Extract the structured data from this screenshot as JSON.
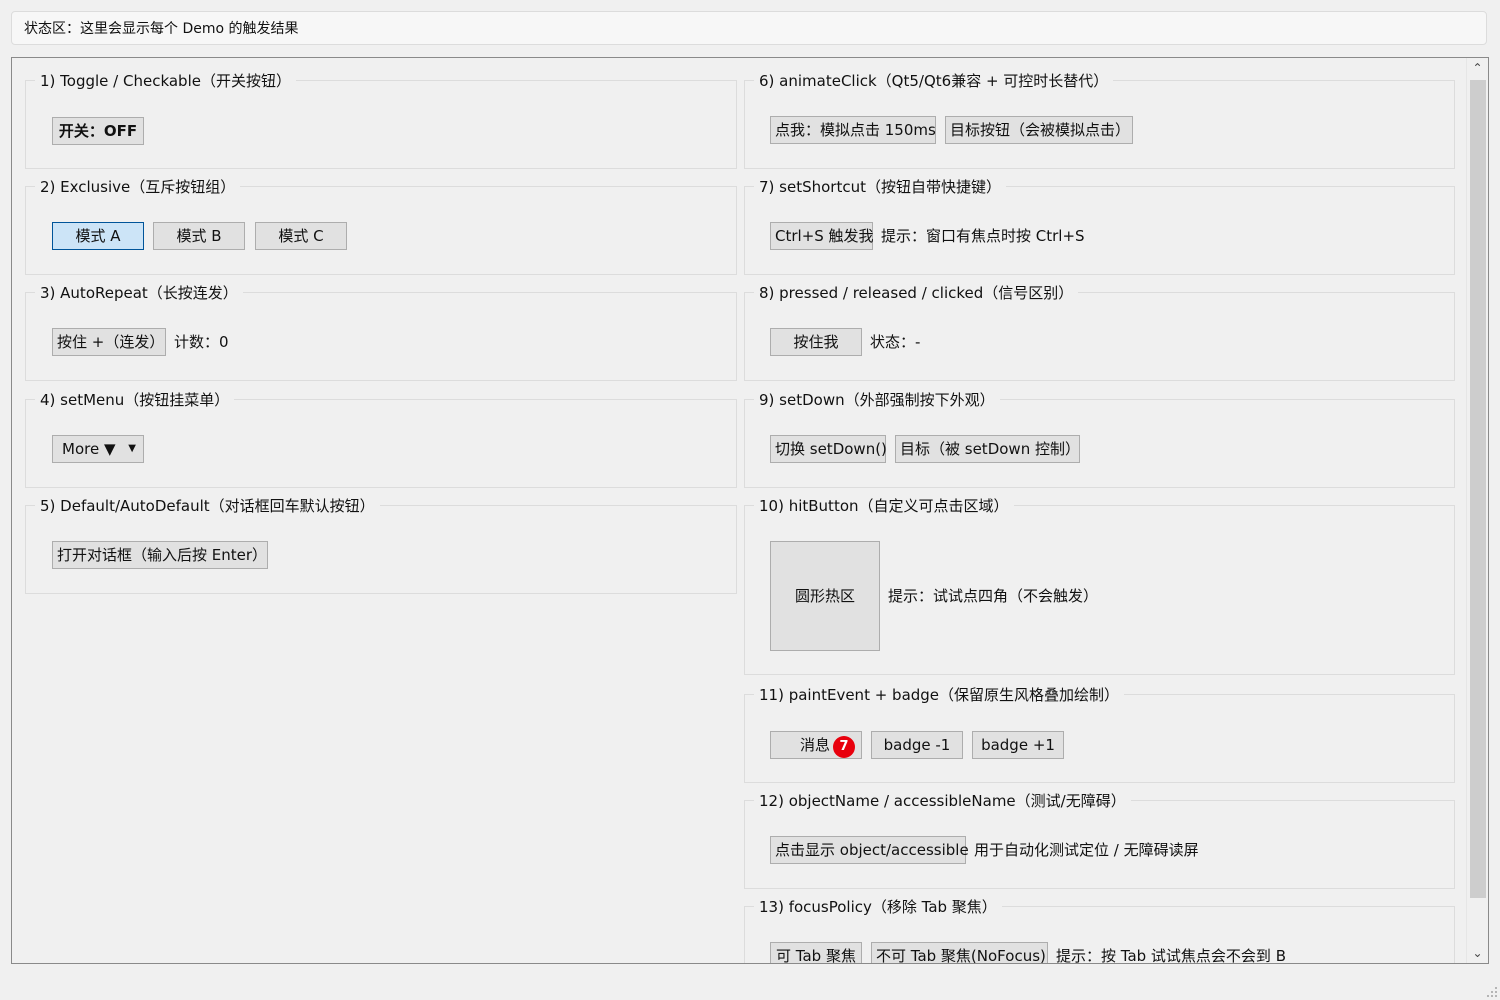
{
  "status_text": "状态区：这里会显示每个 Demo 的触发结果",
  "colors": {
    "badge": "#e8000d",
    "selected": "#cce4f7",
    "button": "#e1e1e1"
  },
  "groups": {
    "g1": {
      "title": "1) Toggle / Checkable（开关按钮）",
      "button": "开关：OFF"
    },
    "g2": {
      "title": "2) Exclusive（互斥按钮组）",
      "buttons": [
        "模式 A",
        "模式 B",
        "模式 C"
      ],
      "selected": "模式 A"
    },
    "g3": {
      "title": "3) AutoRepeat（长按连发）",
      "button": "按住 +（连发）",
      "label": "计数：0"
    },
    "g4": {
      "title": "4) setMenu（按钮挂菜单）",
      "button": "More ▼"
    },
    "g5": {
      "title": "5) Default/AutoDefault（对话框回车默认按钮）",
      "button": "打开对话框（输入后按 Enter）"
    },
    "g6": {
      "title": "6) animateClick（Qt5/Qt6兼容 + 可控时长替代）",
      "buttons": [
        "点我：模拟点击 150ms",
        "目标按钮（会被模拟点击）"
      ]
    },
    "g7": {
      "title": "7) setShortcut（按钮自带快捷键）",
      "button": "Ctrl+S 触发我",
      "label": "提示：窗口有焦点时按 Ctrl+S"
    },
    "g8": {
      "title": "8) pressed / released / clicked（信号区别）",
      "button": "按住我",
      "label": "状态：-"
    },
    "g9": {
      "title": "9) setDown（外部强制按下外观）",
      "buttons": [
        "切换 setDown()",
        "目标（被 setDown 控制）"
      ]
    },
    "g10": {
      "title": "10) hitButton（自定义可点击区域）",
      "button": "圆形热区",
      "label": "提示：试试点四角（不会触发）"
    },
    "g11": {
      "title": "11) paintEvent + badge（保留原生风格叠加绘制）",
      "buttons": [
        "消息",
        "badge -1",
        "badge +1"
      ],
      "badge_count": "7"
    },
    "g12": {
      "title": "12) objectName / accessibleName（测试/无障碍）",
      "button": "点击显示 object/accessible",
      "label": "用于自动化测试定位 / 无障碍读屏"
    },
    "g13": {
      "title": "13) focusPolicy（移除 Tab 聚焦）",
      "buttons": [
        "可 Tab 聚焦",
        "不可 Tab 聚焦(NoFocus)"
      ],
      "label": "提示：按 Tab 试试焦点会不会到 B"
    }
  }
}
